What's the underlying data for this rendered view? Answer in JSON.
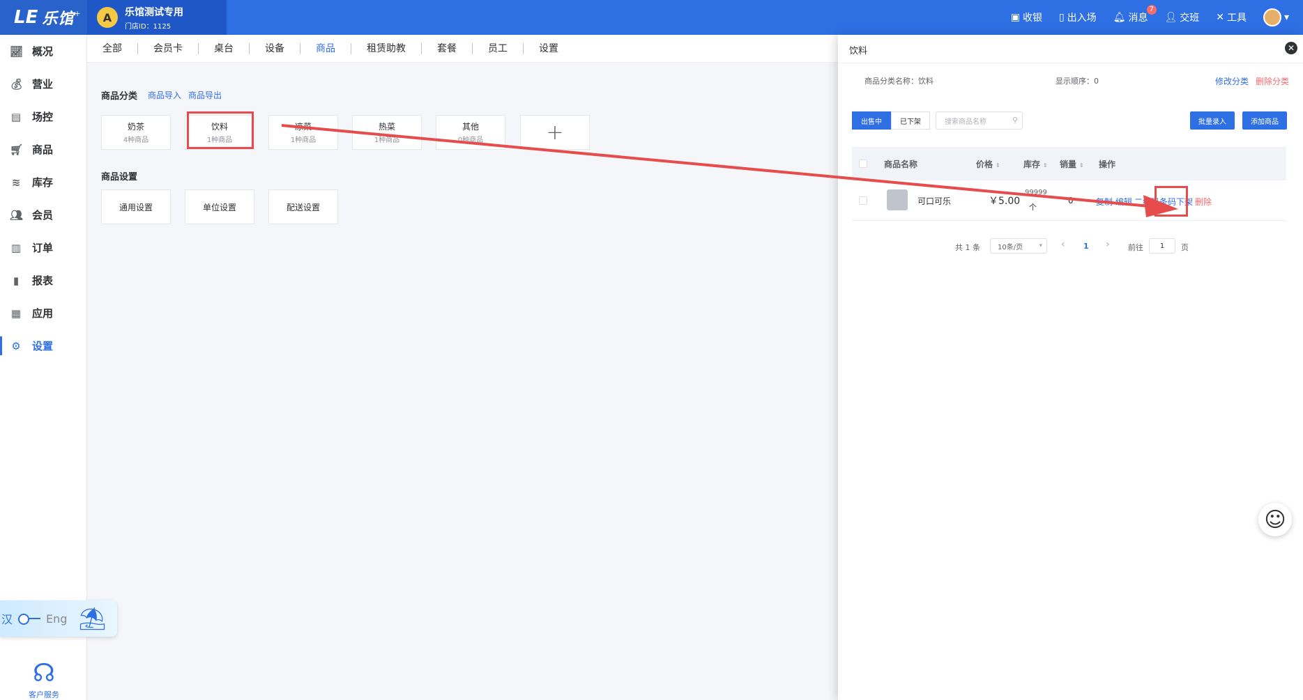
{
  "topbar": {
    "logo_mark": "LE",
    "logo_text": "乐馆",
    "logo_sup": "+",
    "store_initial": "A",
    "store_name": "乐馆测试专用",
    "store_id": "门店ID：1125",
    "actions": {
      "checkout": "收银",
      "entry": "出入场",
      "message": "消息",
      "message_badge": "7",
      "handover": "交班",
      "tools": "工具"
    }
  },
  "sidebar": {
    "items": [
      {
        "label": "概况",
        "icon": "chart-icon"
      },
      {
        "label": "营业",
        "icon": "money-bag-icon"
      },
      {
        "label": "场控",
        "icon": "monitor-icon"
      },
      {
        "label": "商品",
        "icon": "cart-icon"
      },
      {
        "label": "库存",
        "icon": "layers-icon"
      },
      {
        "label": "会员",
        "icon": "users-icon"
      },
      {
        "label": "订单",
        "icon": "document-icon"
      },
      {
        "label": "报表",
        "icon": "bar-chart-icon"
      },
      {
        "label": "应用",
        "icon": "apps-icon"
      },
      {
        "label": "设置",
        "icon": "gear-icon"
      }
    ],
    "active": "设置",
    "lang_cn": "汉",
    "lang_en": "Eng",
    "customer_service": "客户服务"
  },
  "tabs": [
    "全部",
    "会员卡",
    "桌台",
    "设备",
    "商品",
    "租赁助教",
    "套餐",
    "员工",
    "设置"
  ],
  "tabs_active": "商品",
  "main": {
    "category_title": "商品分类",
    "import_link": "商品导入",
    "export_link": "商品导出",
    "categories": [
      {
        "name": "奶茶",
        "count": "4种商品"
      },
      {
        "name": "饮料",
        "count": "1种商品"
      },
      {
        "name": "凉菜",
        "count": "1种商品"
      },
      {
        "name": "热菜",
        "count": "1种商品"
      },
      {
        "name": "其他",
        "count": "0种商品"
      }
    ],
    "add_symbol": "+",
    "settings_title": "商品设置",
    "settings": [
      "通用设置",
      "单位设置",
      "配送设置"
    ]
  },
  "drawer": {
    "title": "饮料",
    "close": "✕",
    "category_name_label": "商品分类名称：饮料",
    "display_order_label": "显示顺序：0",
    "edit_category": "修改分类",
    "delete_category": "删除分类",
    "tab_on_sale": "出售中",
    "tab_off_shelf": "已下架",
    "search_placeholder": "搜索商品名称",
    "batch_entry": "批量录入",
    "add_product": "添加商品",
    "columns": {
      "name": "商品名称",
      "price": "价格",
      "stock": "库存",
      "sales": "销量",
      "actions": "操作"
    },
    "rows": [
      {
        "name": "可口可乐",
        "price": "￥5.00",
        "stock": "99999",
        "stock_unit": "个",
        "sales": "0",
        "op_copy": "复制",
        "op_edit": "编辑",
        "op_qr": "二维码条码",
        "op_offshelf": "下架",
        "op_delete": "删除"
      }
    ],
    "pager": {
      "total": "共 1 条",
      "page_size": "10条/页",
      "prev": "‹",
      "current": "1",
      "next": "›",
      "goto_label": "前往",
      "goto_value": "1",
      "page_suffix": "页"
    }
  },
  "colors": {
    "primary": "#2f6fe4",
    "danger": "#f56c6c",
    "annotation": "#e74c4c"
  }
}
